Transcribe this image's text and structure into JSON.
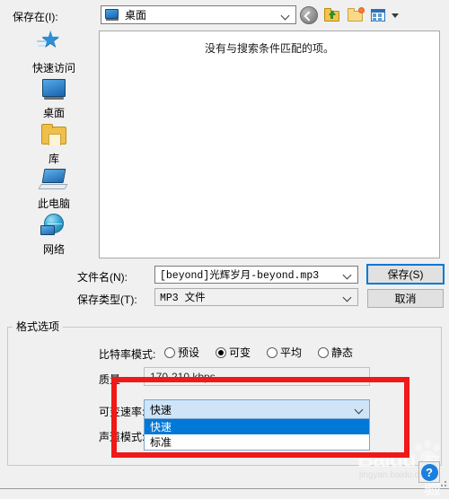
{
  "toolbar": {
    "save_in_label": "保存在(I):",
    "location_value": "桌面",
    "icons": [
      {
        "name": "back-icon",
        "title": "后退"
      },
      {
        "name": "up-folder-icon",
        "title": "上一级"
      },
      {
        "name": "new-folder-icon",
        "title": "新建文件夹"
      },
      {
        "name": "views-icon",
        "title": "视图"
      }
    ]
  },
  "places": {
    "items": [
      {
        "label": "快速访问",
        "icon": "star-icon"
      },
      {
        "label": "桌面",
        "icon": "monitor-icon"
      },
      {
        "label": "库",
        "icon": "folder-icon"
      },
      {
        "label": "此电脑",
        "icon": "computer-icon"
      },
      {
        "label": "网络",
        "icon": "globe-icon"
      }
    ]
  },
  "filelist": {
    "empty_message": "没有与搜索条件匹配的项。"
  },
  "form": {
    "filename_label": "文件名(N):",
    "filename_value": "[beyond]光辉岁月-beyond.mp3",
    "filetype_label": "保存类型(T):",
    "filetype_value": "MP3 文件",
    "save_button": "保存(S)",
    "cancel_button": "取消"
  },
  "format_options": {
    "group_title": "格式选项",
    "bitrate_label": "比特率模式:",
    "bitrate_options": [
      {
        "label": "预设",
        "selected": false
      },
      {
        "label": "可变",
        "selected": true
      },
      {
        "label": "平均",
        "selected": false
      },
      {
        "label": "静态",
        "selected": false
      }
    ],
    "quality_label": "质量",
    "quality_value": "170-210 kbps",
    "vbr_label": "可变速率:",
    "vbr_value": "快速",
    "vbr_options": [
      {
        "label": "快速",
        "selected": true
      },
      {
        "label": "标准",
        "selected": false
      }
    ],
    "channel_label": "声道模式:"
  },
  "annotation": {
    "highlight_color": "#f01818"
  },
  "watermark": {
    "brand": "Baidu",
    "brand_cn": "经验",
    "url": "jingyan.baidu.com"
  },
  "help": {
    "label": "?"
  }
}
